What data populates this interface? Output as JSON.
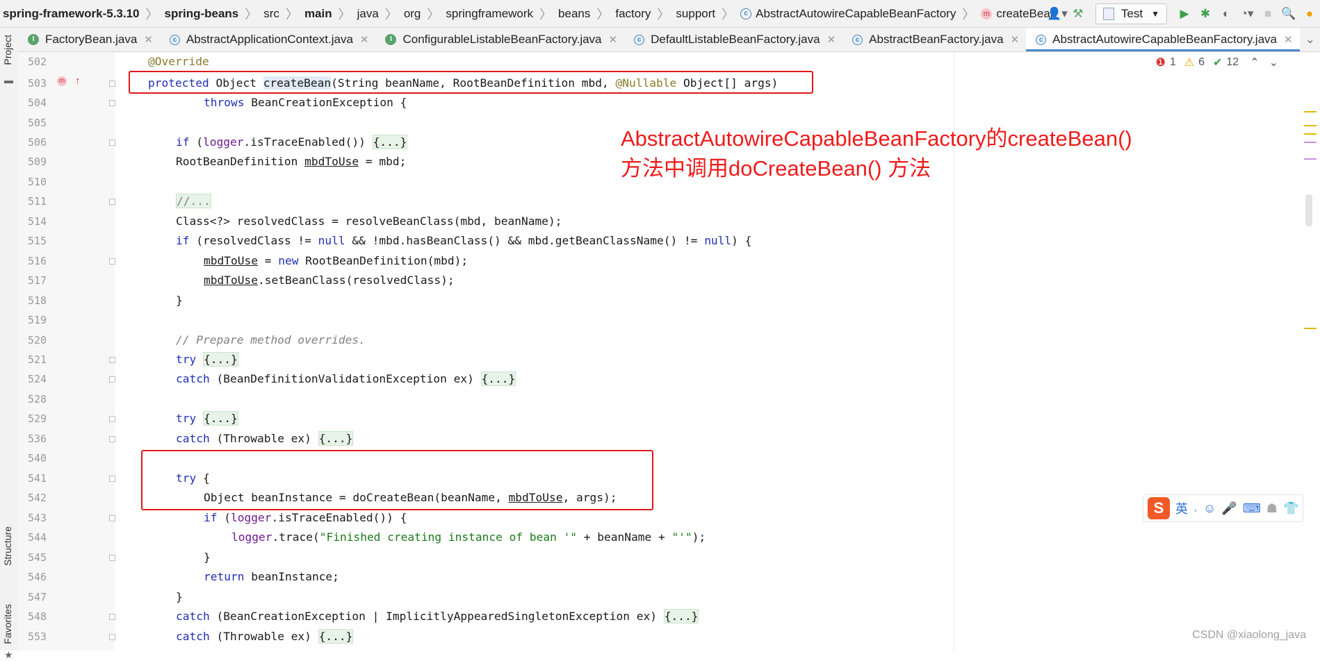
{
  "breadcrumb": [
    "spring-framework-5.3.10",
    "spring-beans",
    "src",
    "main",
    "java",
    "org",
    "springframework",
    "beans",
    "factory",
    "support",
    "AbstractAutowireCapableBeanFactory",
    "createBean"
  ],
  "toolbar": {
    "run_config": "Test"
  },
  "sidebar": {
    "project": "Project",
    "structure": "Structure",
    "favorites": "Favorites"
  },
  "tabs": [
    {
      "label": "FactoryBean.java",
      "kind": "I"
    },
    {
      "label": "AbstractApplicationContext.java",
      "kind": "C"
    },
    {
      "label": "ConfigurableListableBeanFactory.java",
      "kind": "I"
    },
    {
      "label": "DefaultListableBeanFactory.java",
      "kind": "C"
    },
    {
      "label": "AbstractBeanFactory.java",
      "kind": "C"
    },
    {
      "label": "AbstractAutowireCapableBeanFactory.java",
      "kind": "C"
    }
  ],
  "inspections": {
    "errors": "1",
    "warnings": "6",
    "ok": "12"
  },
  "line_numbers": [
    "502",
    "503",
    "504",
    "505",
    "506",
    "509",
    "510",
    "511",
    "514",
    "515",
    "516",
    "517",
    "518",
    "519",
    "520",
    "521",
    "524",
    "528",
    "529",
    "536",
    "540",
    "541",
    "542",
    "543",
    "544",
    "545",
    "546",
    "547",
    "548",
    "553"
  ],
  "annotation": {
    "line1": "AbstractAutowireCapableBeanFactory的createBean()",
    "line2": "方法中调用doCreateBean() 方法"
  },
  "ime": {
    "label": "英"
  },
  "watermark": "CSDN @xiaolong_java"
}
